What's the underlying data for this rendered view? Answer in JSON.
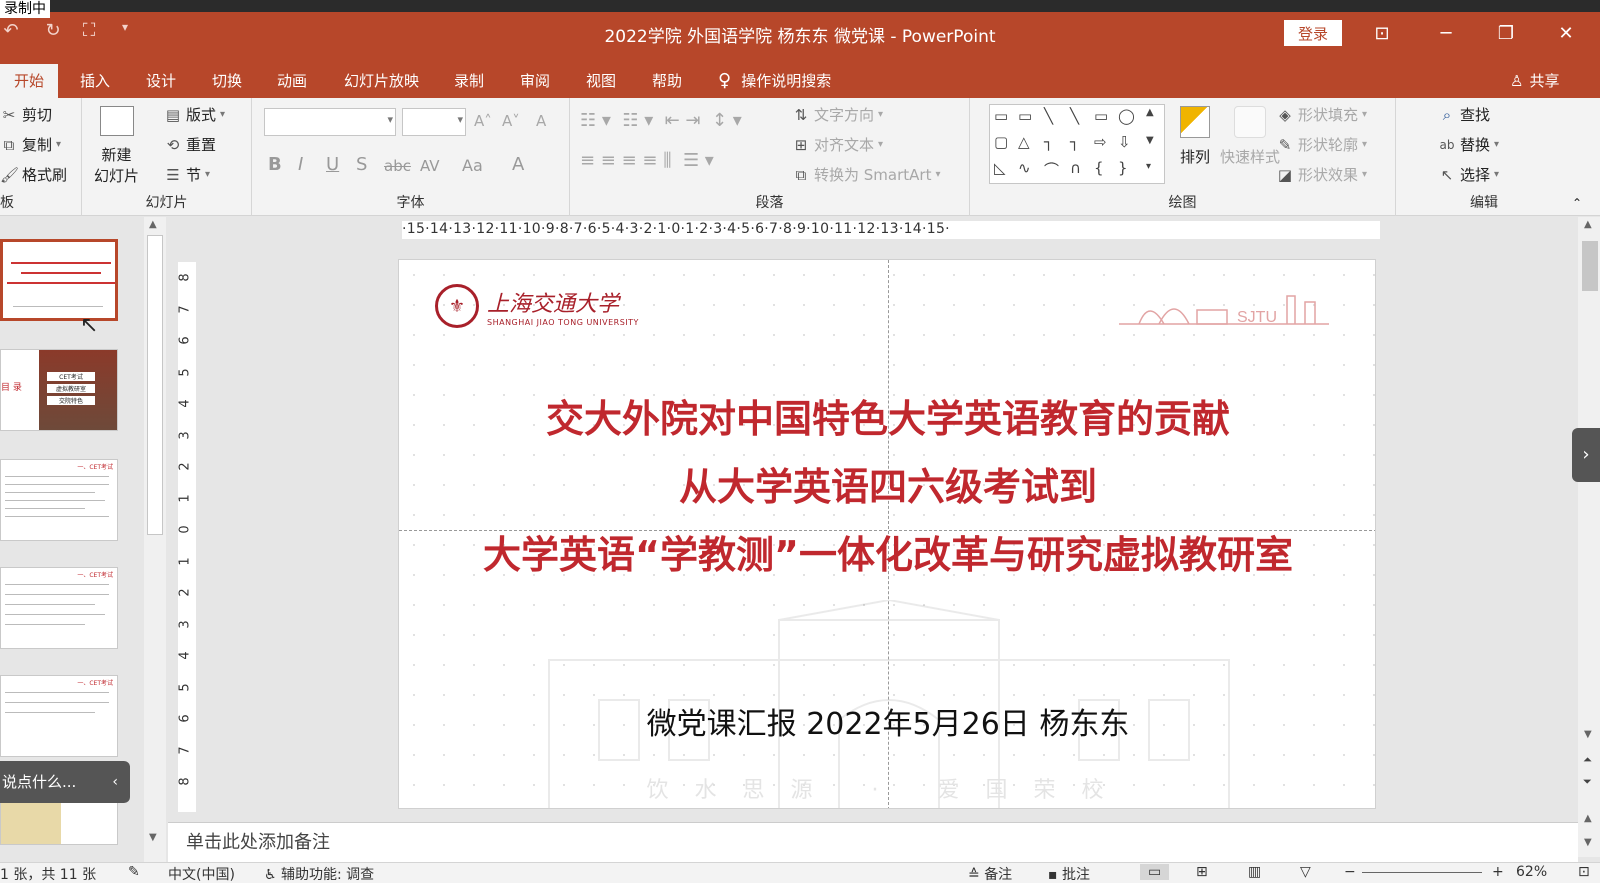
{
  "recording_label": "录制中",
  "window": {
    "title": "2022学院 外国语学院 杨东东 微党课 - PowerPoint",
    "login": "登录",
    "controls": {
      "restore_ribbon": "⊡",
      "minimize": "─",
      "maximize": "❐",
      "close": "✕"
    }
  },
  "qat": {
    "undo": "↶",
    "redo": "↻",
    "present": "⛶",
    "more": "▾"
  },
  "tabs": [
    {
      "label": "开始",
      "active": true
    },
    {
      "label": "插入"
    },
    {
      "label": "设计"
    },
    {
      "label": "切换"
    },
    {
      "label": "动画"
    },
    {
      "label": "幻灯片放映"
    },
    {
      "label": "录制"
    },
    {
      "label": "审阅"
    },
    {
      "label": "视图"
    },
    {
      "label": "帮助"
    }
  ],
  "tellme": {
    "icon": "lightbulb-icon",
    "label": "操作说明搜索"
  },
  "share": {
    "label": "共享"
  },
  "ribbon": {
    "clipboard": {
      "cut": "剪切",
      "copy": "复制",
      "format_painter": "格式刷",
      "group": "板"
    },
    "slides": {
      "new_line1": "新建",
      "new_line2": "幻灯片",
      "layout": "版式",
      "reset": "重置",
      "section": "节",
      "group": "幻灯片"
    },
    "font": {
      "bold": "B",
      "italic": "I",
      "underline": "U",
      "shadow": "S",
      "strike": "abc",
      "spacing": "AV",
      "case": "Aa",
      "color": "A",
      "grow": "A˄",
      "shrink": "A˅",
      "clear": "A",
      "group": "字体"
    },
    "paragraph": {
      "text_direction": "文字方向",
      "align_text": "对齐文本",
      "smartart": "转换为 SmartArt",
      "group": "段落"
    },
    "drawing": {
      "arrange": "排列",
      "quick_styles": "快速样式",
      "fill": "形状填充",
      "outline": "形状轮廓",
      "effects": "形状效果",
      "group": "绘图"
    },
    "editing": {
      "find": "查找",
      "replace": "替换",
      "select": "选择",
      "group": "编辑"
    }
  },
  "slide": {
    "logo_cn": "上海交通大学",
    "logo_en": "SHANGHAI JIAO TONG UNIVERSITY",
    "logo_mark": "SJTU",
    "title_line1": "交大外院对中国特色大学英语教育的贡献",
    "title_line2": "从大学英语四六级考试到",
    "title_line3": "大学英语“学教测”一体化改革与研究虚拟教研室",
    "subtitle": "微党课汇报   2022年5月26日  杨东东",
    "motto": "饮水思源 · 爱国荣校"
  },
  "hruler": "·15·14·13·12·11·10·9·8·7·6·5·4·3·2·1·0·1·2·3·4·5·6·7·8·9·10·11·12·13·14·15·",
  "vruler_ticks": [
    "8",
    "7",
    "6",
    "5",
    "4",
    "3",
    "2",
    "1",
    "0",
    "1",
    "2",
    "3",
    "4",
    "5",
    "6",
    "7",
    "8"
  ],
  "thumb_texts": {
    "toc": "目 录",
    "item1": "CET考试",
    "item2": "虚拟教研室",
    "item3": "交院特色",
    "section": "一、CET考试"
  },
  "comment_placeholder": "说点什么...",
  "notes_placeholder": "单击此处添加备注",
  "status": {
    "slide_count": "1 张，共 11 张",
    "language": "中文(中国)",
    "accessibility": "辅助功能: 调查",
    "notes": "备注",
    "comments": "批注",
    "zoom": "62%"
  }
}
